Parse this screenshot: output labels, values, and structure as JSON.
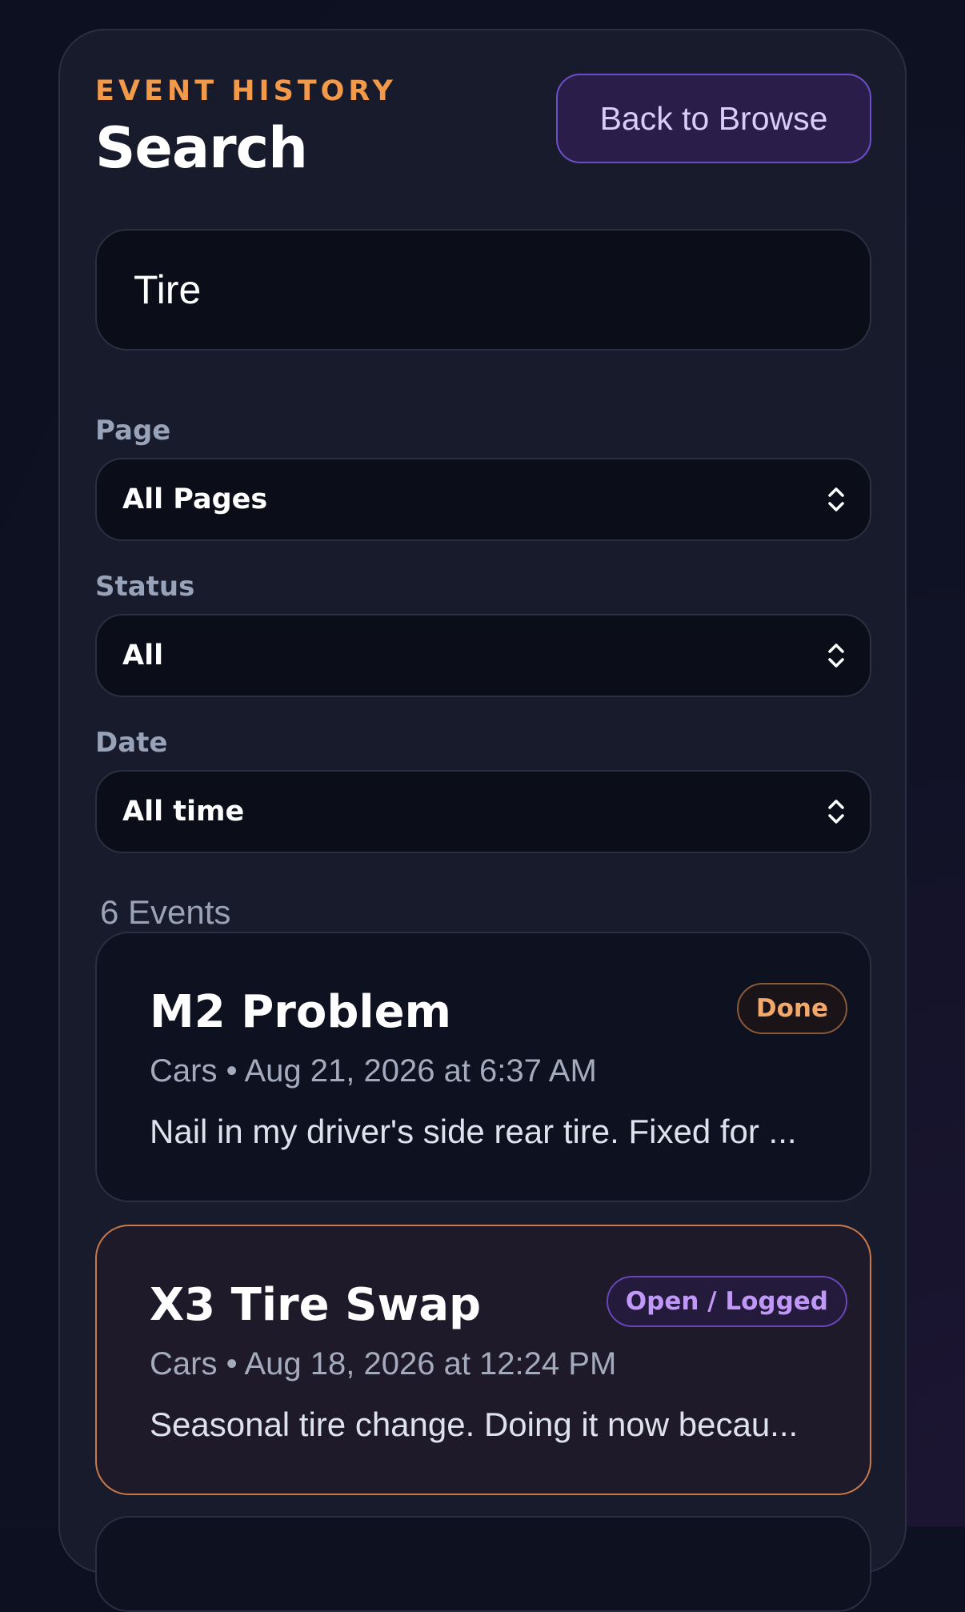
{
  "header": {
    "eyebrow": "EVENT HISTORY",
    "title": "Search",
    "back_label": "Back to Browse"
  },
  "search": {
    "value": "Tire"
  },
  "filters": {
    "page": {
      "label": "Page",
      "value": "All Pages"
    },
    "status": {
      "label": "Status",
      "value": "All"
    },
    "date": {
      "label": "Date",
      "value": "All time"
    }
  },
  "results": {
    "count_label": "6 Events",
    "events": [
      {
        "title": "M2 Problem",
        "status": "Done",
        "meta": "Cars • Aug 21, 2026 at 6:37 AM",
        "body": "Nail in my driver's side rear tire. Fixed for ..."
      },
      {
        "title": "X3 Tire Swap",
        "status": "Open / Logged",
        "meta": "Cars • Aug 18, 2026 at 12:24 PM",
        "body": "Seasonal tire change. Doing it now becau..."
      }
    ]
  },
  "colors": {
    "accent_orange": "#f2994a",
    "accent_purple": "#6b4fc8",
    "panel_bg": "#171b2b"
  },
  "icons": {
    "select_chevron": "chevron-up-down-icon"
  }
}
